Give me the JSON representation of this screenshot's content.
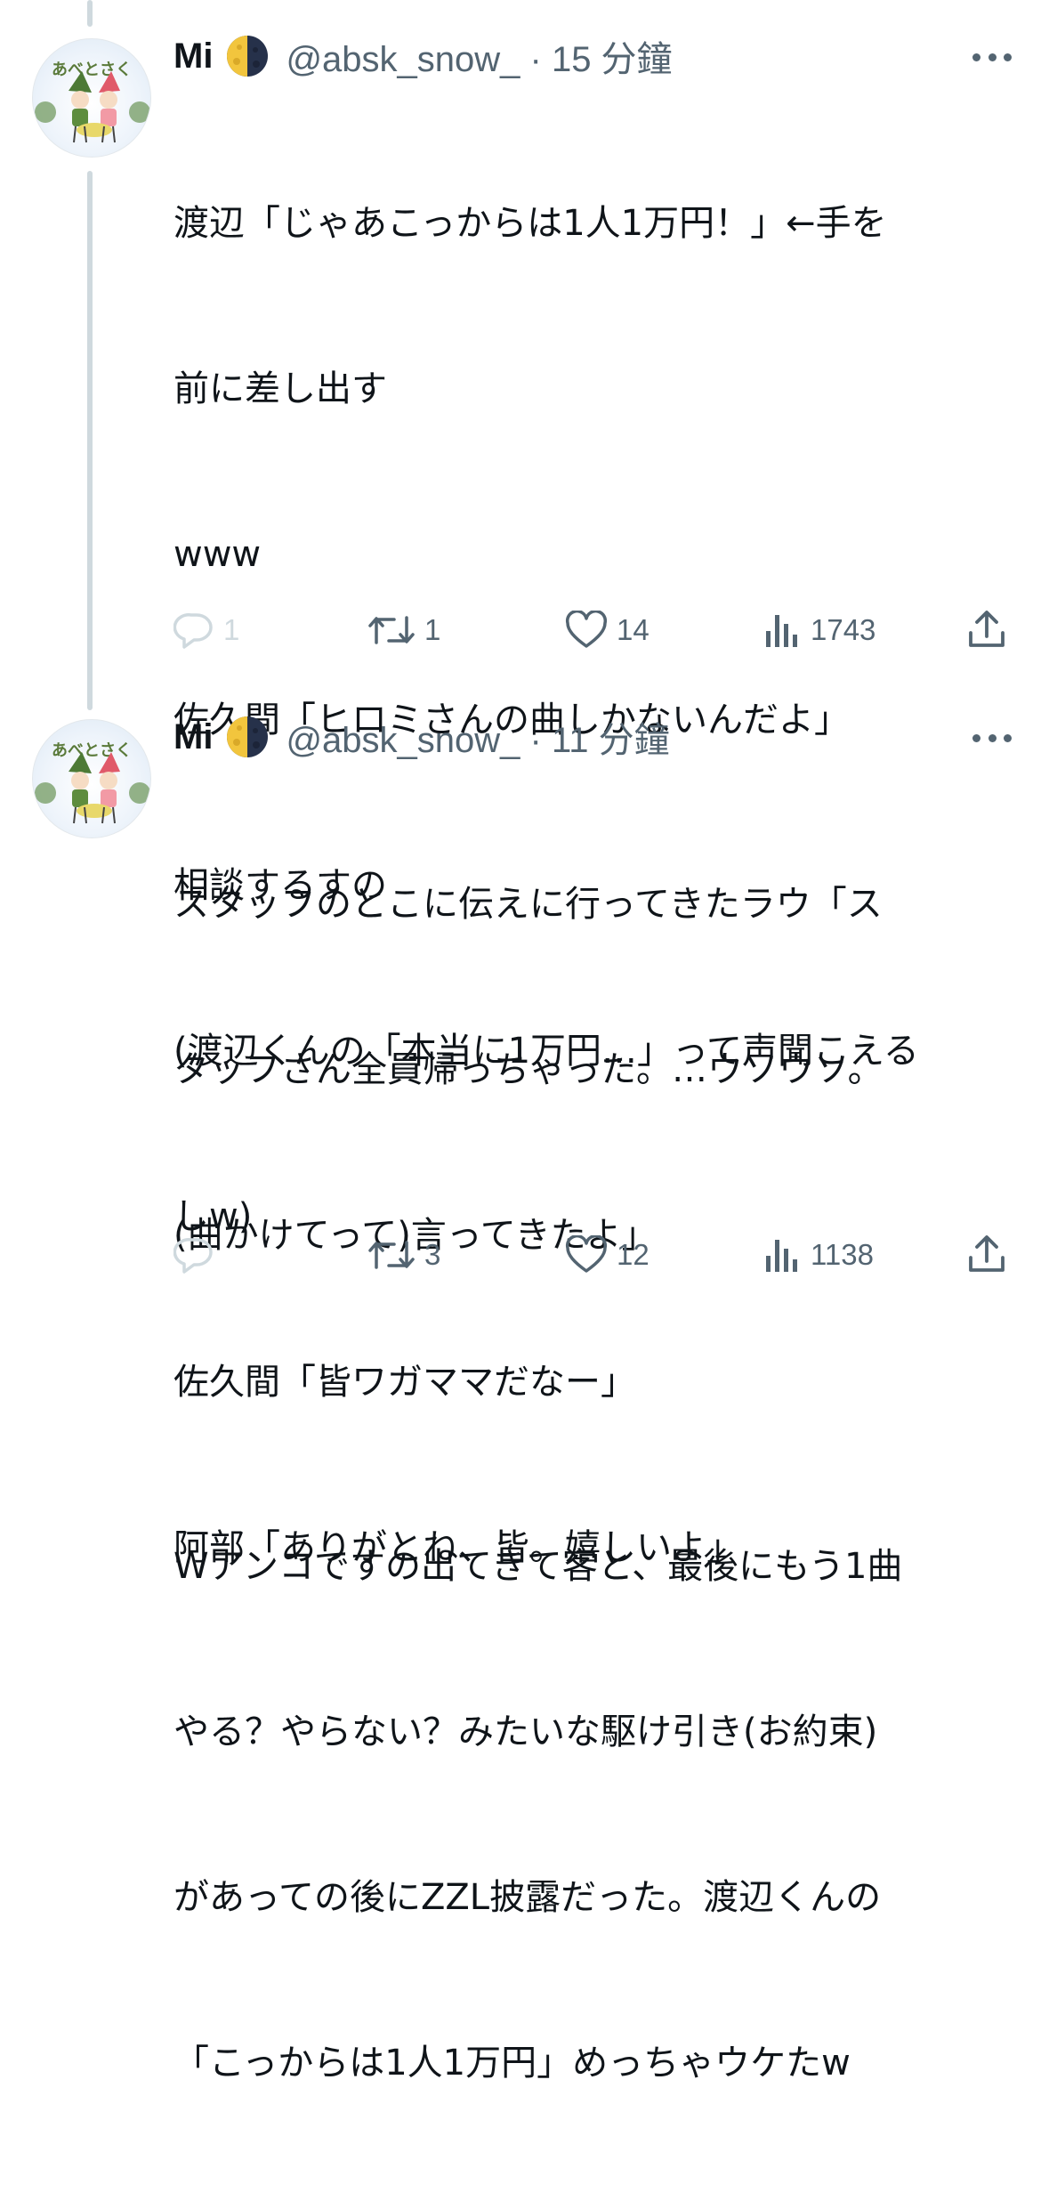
{
  "tweets": [
    {
      "author_name": "Mi",
      "handle_time": "@absk_snow_ · 15 分鐘",
      "avatar_label": "あべとさく",
      "lines": [
        "渡辺「じゃあこっからは1人1万円！」←手を",
        "前に差し出す",
        "www",
        "佐久間「ヒロミさんの曲しかないんだよ」",
        "相談するすの",
        "(渡辺くんの「本当に1万円…」って声聞こえる",
        "しw)",
        "佐久間「皆ワガママだなー」",
        "阿部「ありがとね、皆。嬉しいよ」"
      ],
      "replies": "1",
      "retweets": "1",
      "likes": "14",
      "views": "1743"
    },
    {
      "author_name": "Mi",
      "handle_time": "@absk_snow_ · 11 分鐘",
      "avatar_label": "あべとさく",
      "lines": [
        "スタッフのとこに伝えに行ってきたラウ「ス",
        "タッフさん全員帰っちゃった。…ウソウソ。",
        "(曲かけてって)言ってきたよ」",
        "",
        "Wアンコですの出てきて客と、最後にもう1曲",
        "やる？やらない？みたいな駆け引き(お約束)",
        "があっての後にZZL披露だった。渡辺くんの",
        "「こっからは1人1万円」めっちゃウケたw"
      ],
      "replies": "",
      "retweets": "3",
      "likes": "12",
      "views": "1138"
    }
  ],
  "colors": {
    "text": "#0f1419",
    "secondary": "#536471",
    "thread_line": "#cfd9de"
  },
  "icons": [
    "more-icon",
    "reply-icon",
    "retweet-icon",
    "like-icon",
    "views-icon",
    "share-icon",
    "moon-emoji"
  ]
}
